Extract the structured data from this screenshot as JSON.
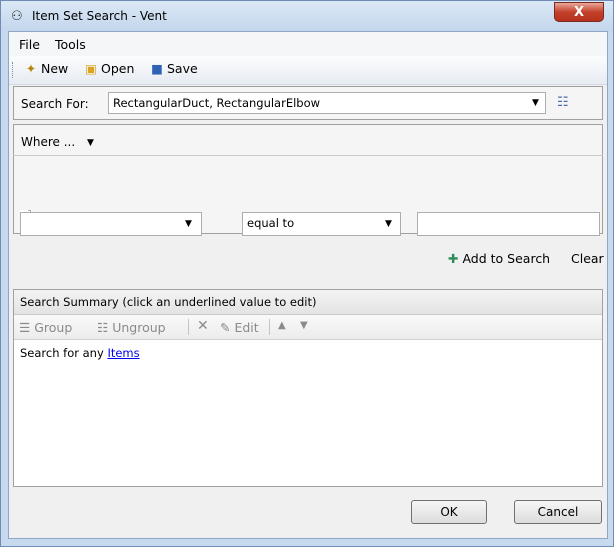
{
  "window": {
    "title": "Item Set Search - Vent",
    "close_label": "X"
  },
  "menu": {
    "file": "File",
    "tools": "Tools"
  },
  "toolbar": {
    "new_label": "New",
    "open_label": "Open",
    "save_label": "Save"
  },
  "search_for": {
    "label": "Search For:",
    "value": "RectangularDuct, RectangularElbow"
  },
  "where": {
    "label": "Where ...",
    "property_value": "",
    "operator_value": "equal to",
    "value_field": "",
    "add_to_search": "Add to Search",
    "clear": "Clear"
  },
  "summary": {
    "header": "Search Summary (click an underlined value to edit)",
    "group": "Group",
    "ungroup": "Ungroup",
    "edit": "Edit",
    "text_prefix": "Search for any",
    "link_text": "Items"
  },
  "footer": {
    "ok": "OK",
    "cancel": "Cancel"
  },
  "colors": {
    "title_bar": "#c6d9ee",
    "close_button": "#c4412b",
    "link": "#0000ee"
  }
}
